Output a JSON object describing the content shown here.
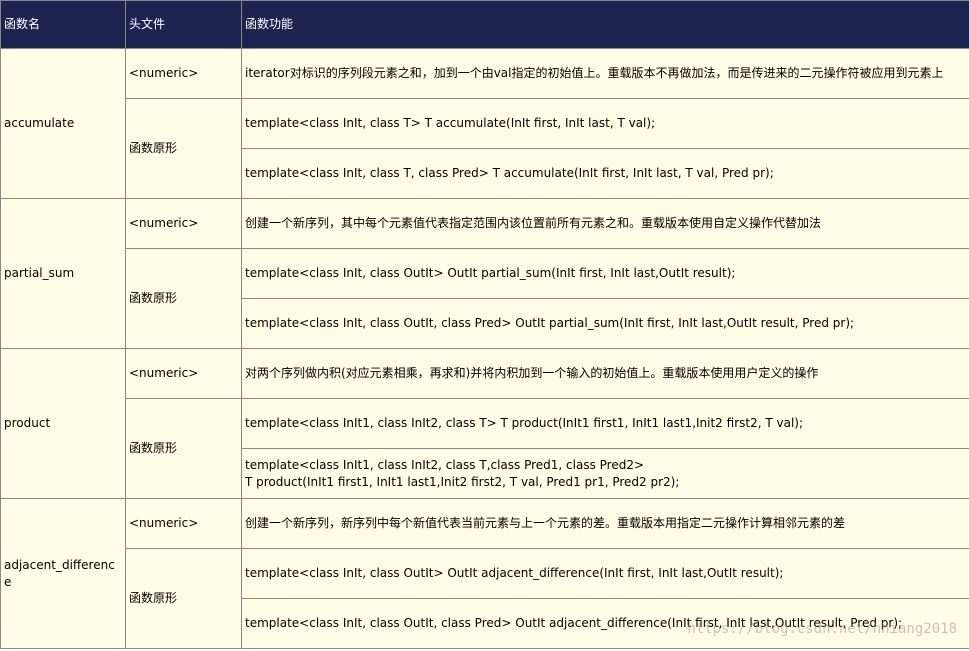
{
  "header": {
    "col_name": "函数名",
    "col_header": "头文件",
    "col_function": "函数功能"
  },
  "functions": [
    {
      "name": "accumulate",
      "header_file": "<numeric>",
      "description": "iterator对标识的序列段元素之和，加到一个由val指定的初始值上。重载版本不再做加法，而是传进来的二元操作符被应用到元素上",
      "prototype_label": "函数原形",
      "prototypes": [
        "template<class InIt, class T> T accumulate(InIt first, InIt last, T val);",
        "template<class InIt, class T, class Pred> T accumulate(InIt first, InIt last, T val, Pred pr);"
      ]
    },
    {
      "name": "partial_sum",
      "header_file": "<numeric>",
      "description": "创建一个新序列，其中每个元素值代表指定范围内该位置前所有元素之和。重载版本使用自定义操作代替加法",
      "prototype_label": "函数原形",
      "prototypes": [
        "template<class InIt, class OutIt> OutIt partial_sum(InIt first, InIt last,OutIt result);",
        "template<class InIt, class OutIt, class Pred> OutIt partial_sum(InIt first, InIt last,OutIt result, Pred pr);"
      ]
    },
    {
      "name": "product",
      "header_file": "<numeric>",
      "description": "对两个序列做内积(对应元素相乘，再求和)并将内积加到一个输入的初始值上。重载版本使用用户定义的操作",
      "prototype_label": "函数原形",
      "prototypes": [
        "template<class InIt1, class InIt2, class T> T product(InIt1 first1, InIt1 last1,Init2 first2, T val);",
        "template<class InIt1, class InIt2, class T,class Pred1, class Pred2>\nT product(InIt1 first1, InIt1 last1,Init2 first2, T val, Pred1 pr1, Pred2 pr2);"
      ]
    },
    {
      "name": "adjacent_difference",
      "header_file": "<numeric>",
      "description": "创建一个新序列，新序列中每个新值代表当前元素与上一个元素的差。重载版本用指定二元操作计算相邻元素的差",
      "prototype_label": "函数原形",
      "prototypes": [
        "template<class InIt, class OutIt> OutIt adjacent_difference(InIt first, InIt last,OutIt result);",
        "template<class InIt, class OutIt, class Pred> OutIt adjacent_difference(InIt first, InIt last,OutIt result, Pred pr);"
      ]
    }
  ],
  "watermark": "https://blog.csdn.net/hhiang2018"
}
